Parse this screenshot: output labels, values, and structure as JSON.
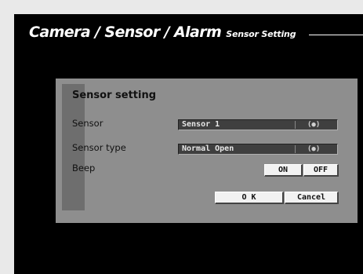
{
  "header": {
    "breadcrumb": "Camera / Sensor / Alarm",
    "subtitle": "Sensor Setting"
  },
  "dialog": {
    "title": "Sensor setting",
    "sensor": {
      "label": "Sensor",
      "value": "Sensor 1",
      "icon": "(●)"
    },
    "sensor_type": {
      "label": "Sensor type",
      "value": "Normal Open",
      "icon": "(●)"
    },
    "beep": {
      "label": "Beep",
      "on_label": "ON",
      "off_label": "OFF"
    },
    "ok_label": "O K",
    "cancel_label": "Cancel"
  },
  "colors": {
    "screen_bg": "#000000",
    "dialog_bg": "#8e8e8e",
    "field_bg": "#3f3f3f",
    "button_bg": "#f2f2f2",
    "page_bg": "#e9e9e9"
  }
}
